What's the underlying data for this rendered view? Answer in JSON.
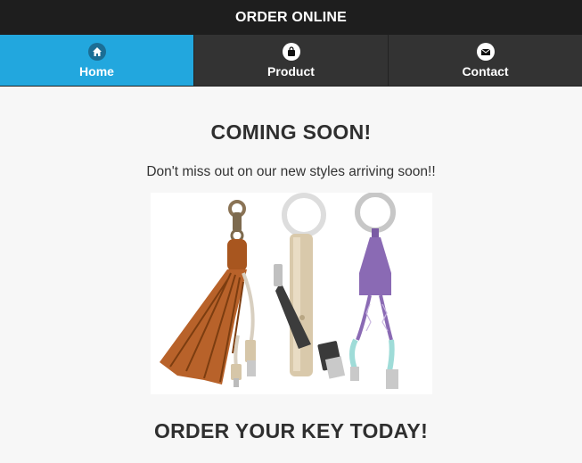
{
  "header": {
    "title": "ORDER ONLINE"
  },
  "nav": {
    "items": [
      {
        "label": "Home",
        "icon": "home-icon",
        "active": true
      },
      {
        "label": "Product",
        "icon": "shopping-bag-icon",
        "active": false
      },
      {
        "label": "Contact",
        "icon": "envelope-icon",
        "active": false
      }
    ]
  },
  "main": {
    "title": "COMING SOON!",
    "subtitle": "Don't miss out on our new styles arriving soon!!",
    "bottom_title": "ORDER YOUR KEY TODAY!"
  },
  "colors": {
    "topbar": "#1e1e1e",
    "nav": "#333333",
    "accent": "#22a7de",
    "background": "#f7f7f7",
    "leather": "#a8561f",
    "gold": "#d6c6a8",
    "purple": "#8a6ab4",
    "mint": "#9fdcd8"
  }
}
